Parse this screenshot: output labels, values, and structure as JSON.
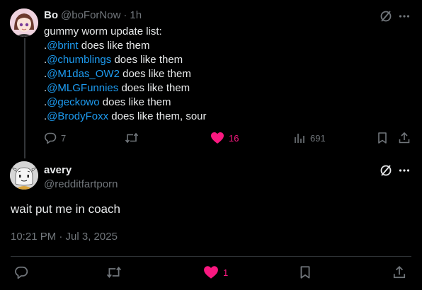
{
  "reply_parent": {
    "author_name": "Bo",
    "author_handle": "@boForNow",
    "dot": "·",
    "time_ago": "1h",
    "lines": [
      {
        "prefix": "",
        "mention": "",
        "text": "gummy worm update list:"
      },
      {
        "prefix": ".",
        "mention": "@brint",
        "text": " does like them"
      },
      {
        "prefix": ".",
        "mention": "@chumblings",
        "text": " does like them"
      },
      {
        "prefix": ".",
        "mention": "@M1das_OW2",
        "text": " does like them"
      },
      {
        "prefix": ".",
        "mention": "@MLGFunnies",
        "text": " does like them"
      },
      {
        "prefix": ".",
        "mention": "@geckowo",
        "text": " does like them"
      },
      {
        "prefix": ".",
        "mention": "@BrodyFoxx",
        "text": " does like them, sour"
      }
    ],
    "stats": {
      "replies": "7",
      "likes": "16",
      "views": "691"
    }
  },
  "main_post": {
    "author_name": "avery",
    "author_handle": "@redditfartporn",
    "text": "wait put me in coach",
    "timestamp": "10:21 PM · Jul 3, 2025",
    "stats": {
      "likes": "1"
    }
  },
  "colors": {
    "background": "#000000",
    "text": "#e7e9ea",
    "muted": "#71767b",
    "mention": "#1d9bf0",
    "like": "#f91880"
  },
  "icons": [
    "grok-icon",
    "more-icon",
    "reply-icon",
    "retweet-icon",
    "heart-filled-icon",
    "views-icon",
    "bookmark-icon",
    "share-icon"
  ]
}
